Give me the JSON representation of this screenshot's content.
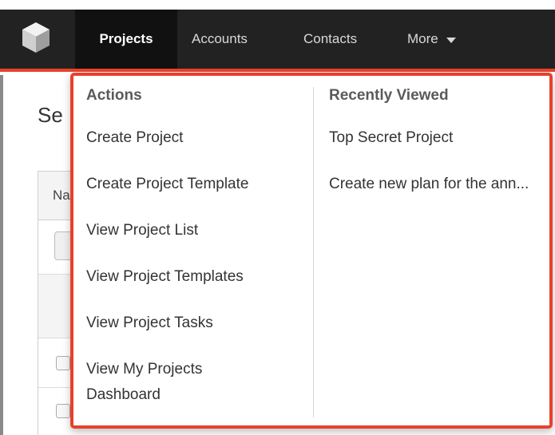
{
  "nav": {
    "logo_icon": "cube-icon",
    "items": [
      {
        "label": "Projects",
        "active": true
      },
      {
        "label": "Accounts",
        "active": false
      },
      {
        "label": "Contacts",
        "active": false
      },
      {
        "label": "More",
        "active": false
      }
    ]
  },
  "background": {
    "heading": "Se",
    "table_header": "Na"
  },
  "dropdown": {
    "actions": {
      "title": "Actions",
      "items": [
        {
          "label": "Create Project"
        },
        {
          "label": "Create Project Template"
        },
        {
          "label": "View Project List"
        },
        {
          "label": "View Project Templates"
        },
        {
          "label": "View Project Tasks"
        },
        {
          "label": "View My Projects Dashboard"
        }
      ]
    },
    "recently_viewed": {
      "title": "Recently Viewed",
      "items": [
        {
          "label": "Top Secret Project"
        },
        {
          "label": "Create new plan for the ann..."
        }
      ]
    }
  },
  "colors": {
    "navbar_bg": "#222222",
    "accent": "#e8412c",
    "active_tab_bg": "#111111"
  }
}
